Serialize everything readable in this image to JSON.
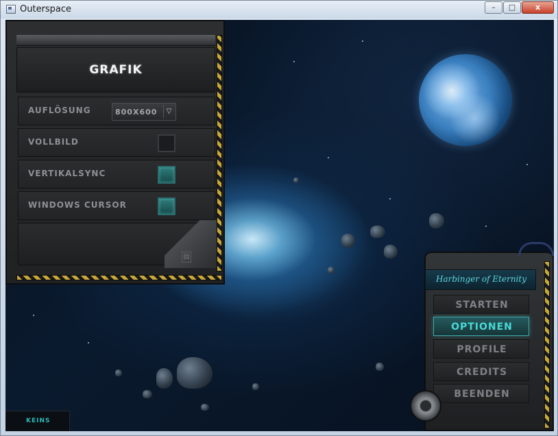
{
  "window": {
    "title": "Outerspace",
    "controls": {
      "minimize": "–",
      "maximize": "□",
      "close": "x"
    }
  },
  "options_panel": {
    "title": "GRAFIK",
    "rows": [
      {
        "label": "AUFLÖSUNG",
        "type": "select",
        "value": "800X600"
      },
      {
        "label": "VOLLBILD",
        "type": "checkbox",
        "checked": false
      },
      {
        "label": "VERTIKALSYNC",
        "type": "checkbox",
        "checked": true
      },
      {
        "label": "WINDOWS CURSOR",
        "type": "checkbox",
        "checked": true
      }
    ]
  },
  "status": {
    "text": "KEINS"
  },
  "main_menu": {
    "title": "Harbinger of Eternity",
    "buttons": [
      {
        "label": "STARTEN",
        "active": false
      },
      {
        "label": "OPTIONEN",
        "active": true
      },
      {
        "label": "PROFILE",
        "active": false
      },
      {
        "label": "CREDITS",
        "active": false
      },
      {
        "label": "BEENDEN",
        "active": false
      }
    ]
  },
  "colors": {
    "accent": "#49d9d6",
    "panel": "#2c2e30",
    "hazard_yellow": "#c9a83a",
    "label_gray": "#8d9094"
  },
  "icons": {
    "dropdown_arrow": "chevron-down-icon",
    "app_icon": "window-app-icon"
  }
}
